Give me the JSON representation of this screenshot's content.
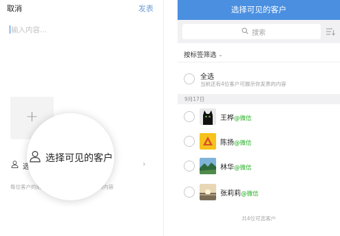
{
  "left": {
    "cancel_label": "取消",
    "publish_label": "发表",
    "compose_placeholder": "输入内容...",
    "add_label": "+",
    "visible_label": "选",
    "hint_text": "每位客户的朋友圈每天最多展示你发表的内容"
  },
  "magnifier": {
    "label": "选择可见的客户"
  },
  "right": {
    "title": "选择可见的客户",
    "search_placeholder": "搜索",
    "filter_label": "按标签筛选",
    "select_all": {
      "title": "全选",
      "subtitle": "当前还有4位客户可展示你发表的内容"
    },
    "date_header": "9月17日",
    "contacts": [
      {
        "name": "王桦",
        "suffix": "@微信",
        "avatar": "black-cat"
      },
      {
        "name": "陈扬",
        "suffix": "@微信",
        "avatar": "yellow-triangle"
      },
      {
        "name": "林华",
        "suffix": "@微信",
        "avatar": "landscape"
      },
      {
        "name": "张莉莉",
        "suffix": "@微信",
        "avatar": "sunset"
      }
    ],
    "footer": "共4位可选客户"
  },
  "colors": {
    "accent_blue": "#4a8fe0",
    "publish_blue": "#6f9fd6",
    "wechat_green": "#1aad19"
  }
}
